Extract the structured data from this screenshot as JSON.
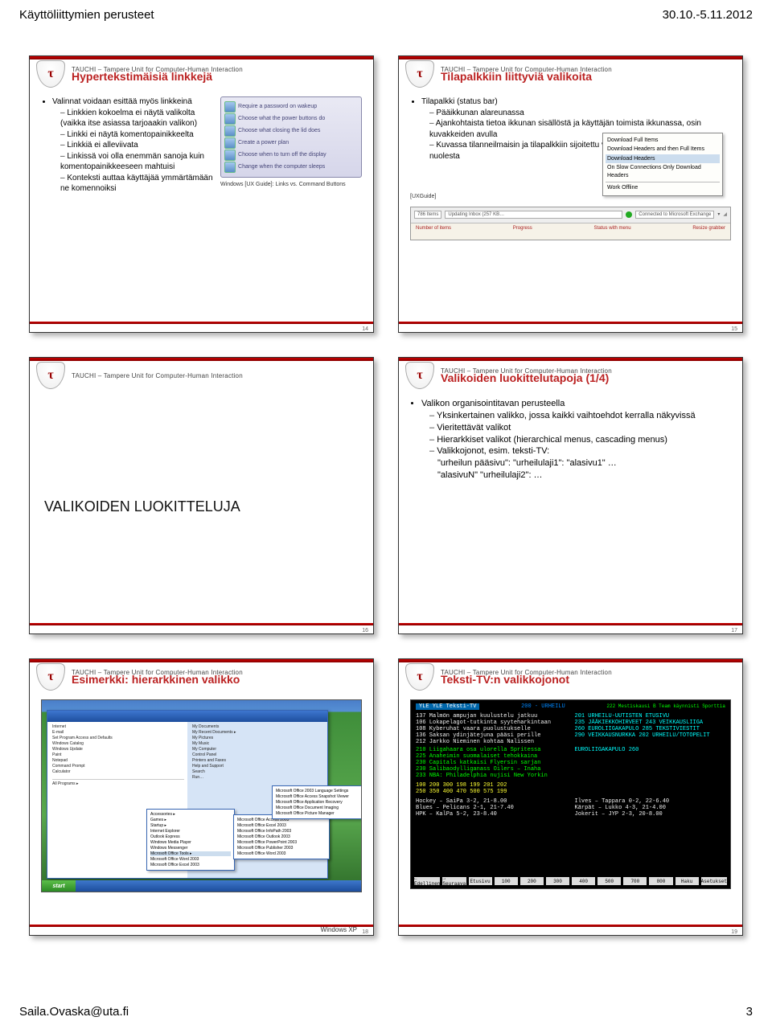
{
  "page": {
    "header_left": "Käyttöliittymien perusteet",
    "header_right": "30.10.-5.11.2012",
    "footer_left": "Saila.Ovaska@uta.fi",
    "footer_right": "3"
  },
  "common": {
    "tauchi": "TAUCHI – Tampere Unit for Computer-Human Interaction",
    "badge_letter": "τ"
  },
  "slide14": {
    "title": "Hypertekstimäisiä linkkejä",
    "lead": "Valinnat voidaan esittää myös linkkeinä",
    "items": [
      "Linkkien kokoelma ei näytä valikolta (vaikka itse asiassa tarjoaakin valikon)",
      "Linkki ei näytä komentopainikkeelta",
      "Linkkiä ei alleviivata",
      "Linkissä voi olla enemmän sanoja kuin komentopainikkeeseen mahtuisi",
      "Konteksti auttaa käyttäjää ymmärtämään ne komennoiksi"
    ],
    "img_lines": [
      "Require a password on wakeup",
      "Choose what the power buttons do",
      "Choose what closing the lid does",
      "Create a power plan",
      "Choose when to turn off the display",
      "Change when the computer sleeps"
    ],
    "caption": "Windows [UX Guide]: Links vs. Command Buttons",
    "num": "14"
  },
  "slide15": {
    "title": "Tilapalkkiin liittyviä valikoita",
    "lead": "Tilapalkki (status bar)",
    "items": [
      "Pääikkunan alareunassa",
      "Ajankohtaista tietoa ikkunan sisällöstä ja käyttäjän toimista ikkunassa, osin kuvakkeiden avulla",
      "Kuvassa tilanneilmaisin ja tilapalkkiin sijoitettu valikko, jonka käyttäjä on avannut nuolesta"
    ],
    "ux_label": "[UXGuide]",
    "popup": [
      "Download Full Items",
      "Download Headers and then Full Items",
      "Download Headers",
      "On Slow Connections Only Download Headers",
      "Work Offline"
    ],
    "status_left": "786 Items",
    "status_mid": "Updating Inbox (257 KB…",
    "status_conn": "Connected to Microsoft Exchange",
    "axis": [
      "Number of items",
      "Progress",
      "Status with menu",
      "Resize grabber"
    ],
    "num": "15"
  },
  "slide16": {
    "title": "VALIKOIDEN LUOKITTELUJA",
    "num": "16"
  },
  "slide17": {
    "title": "Valikoiden luokittelutapoja (1/4)",
    "lead": "Valikon organisointitavan perusteella",
    "items": [
      "Yksinkertainen valikko, jossa kaikki vaihtoehdot kerralla näkyvissä",
      "Vieritettävät valikot",
      "Hierarkkiset valikot (hierarchical menus, cascading menus)",
      "Valikkojonot, esim. teksti-TV:"
    ],
    "tail1": "\"urheilun pääsivu\": \"urheilulaji1\": \"alasivu1\" …",
    "tail2": "\"alasivuN\" \"urheilulaji2\": …",
    "num": "17"
  },
  "slide18": {
    "title": "Esimerkki: hierarkkinen valikko",
    "caption": "Windows XP",
    "startmenu_left": [
      "Internet",
      "E-mail",
      "Set Program Access and Defaults",
      "Windows Catalog",
      "Windows Update",
      "Paint",
      "Notepad",
      "Command Prompt",
      "Calculator",
      "All Programs ▸"
    ],
    "startmenu_right": [
      "My Documents",
      "My Recent Documents ▸",
      "My Pictures",
      "My Music",
      "My Computer",
      "Control Panel",
      "Printers and Faxes",
      "Help and Support",
      "Search",
      "Run…"
    ],
    "fly1": [
      "Accessories ▸",
      "Games ▸",
      "Startup ▸",
      "Internet Explorer",
      "Outlook Express",
      "Windows Media Player",
      "Windows Messenger",
      "Microsoft Office Tools ▸",
      "Microsoft Office Word 2003",
      "Microsoft Office Excel 2003"
    ],
    "fly2": [
      "Microsoft Office Access 2003",
      "Microsoft Office Excel 2003",
      "Microsoft Office InfoPath 2003",
      "Microsoft Office Outlook 2003",
      "Microsoft Office PowerPoint 2003",
      "Microsoft Office Publisher 2003",
      "Microsoft Office Word 2003"
    ],
    "fly3": [
      "Microsoft Office 2003 Language Settings",
      "Microsoft Office Access Snapshot Viewer",
      "Microsoft Office Application Recovery",
      "Microsoft Office Document Imaging",
      "Microsoft Office Picture Manager"
    ],
    "start_btn": "start",
    "num": "18"
  },
  "slide19": {
    "title": "Teksti-TV:n valikkojonot",
    "yle": "YLE  YLE Teksti-TV",
    "page": "200 - URHEILU",
    "hdr_right": "222 Mestiskausi B Team käynnisti Sporttia",
    "news": [
      "137 Malmön ampujan kuulustelu jatkuu",
      "106 Lokapelagot-tutkinta syyteharkintaan",
      "108 Kyberuhat vaara puolustukselle",
      "136 Saksan ydinjätejuna pääsi perille",
      "212 Jarkko Nieminen kohtaa Nalissen"
    ],
    "right_col": [
      "201 URHEILU-UUTISTEN ETUSIVU",
      "235 JÄÄKIEKKOHIRVEET  243 VEIKKAUSLIIGA",
      "260 EUROLIIGAKAPULO  285 TEKSTIVIESTIT",
      "290 VEIKKAUSNURKKA  202 URHEILU/TOTOPELIT"
    ],
    "mid_col": [
      "210 Liigahaara osa ulorella Spritessa",
      "225 Anaheimin suomalaiset tehokkaina",
      "230 Capitals katkaisi Flyersin sarjan",
      "230 Salibaodylliganass Oilers – Inaha",
      "233 NBA: Philadelphia nujisi New Yorkin"
    ],
    "euroliiga": "EUROLIIGAKAPULO 260",
    "yellow_rows": [
      "100 200 300 198 199 201 202",
      "250 350 400 470 500 575 199"
    ],
    "match_block": [
      "Hockey – SaiPa  3-2, 21-8.00",
      "Blues – Pelicans  2-1, 21-7.40",
      "HPK – KalPa  5-2, 23-8.40",
      "Ilves – Tappara  0-2, 22-6.40",
      "Kärpät – Lukko  4-3, 21-4.00",
      "Jokerit – JYP  2-3, 20-8.00"
    ],
    "bottom_btns": [
      "← Edellinen",
      "→ Seuraava",
      "Etusivu",
      "100",
      "200",
      "300",
      "400",
      "500",
      "700",
      "800",
      "Haku",
      "Asetukset"
    ],
    "num": "19"
  }
}
